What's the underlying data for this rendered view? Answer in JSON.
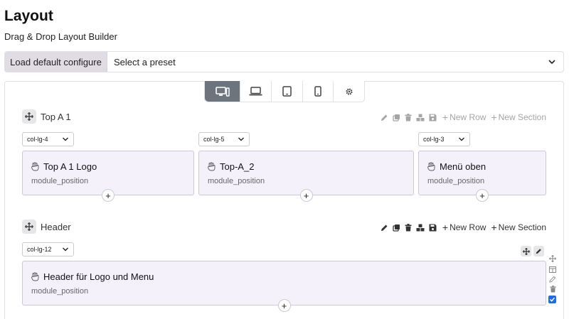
{
  "page": {
    "title": "Layout",
    "subtitle": "Drag & Drop Layout Builder"
  },
  "preset": {
    "button_label": "Load default configure",
    "select_value": "Select a preset"
  },
  "devices": [
    {
      "name": "desktop-icon",
      "active": true
    },
    {
      "name": "laptop-icon",
      "active": false
    },
    {
      "name": "tablet-icon",
      "active": false
    },
    {
      "name": "mobile-icon",
      "active": false
    },
    {
      "name": "gear-icon",
      "active": false
    }
  ],
  "toolbar_labels": {
    "new_row": "New Row",
    "new_section": "New Section"
  },
  "sections": [
    {
      "title": "Top A 1",
      "toolbar_state": "muted",
      "columns": [
        {
          "class": "col-lg-4",
          "module_title": "Top A 1 Logo",
          "module_sub": "module_position"
        },
        {
          "class": "col-lg-5",
          "module_title": "Top-A_2",
          "module_sub": "module_position"
        },
        {
          "class": "col-lg-3",
          "module_title": "Menü oben",
          "module_sub": "module_position"
        }
      ]
    },
    {
      "title": "Header",
      "toolbar_state": "active",
      "columns": [
        {
          "class": "col-lg-12",
          "module_title": "Header für Logo und Menu",
          "module_sub": "module_position"
        }
      ]
    }
  ],
  "add_symbol": "+",
  "colors": {
    "module_bg": "#f5f1fb",
    "module_border": "#cfc6da",
    "active_device": "#6c757d",
    "checkbox": "#1b6ee8"
  }
}
